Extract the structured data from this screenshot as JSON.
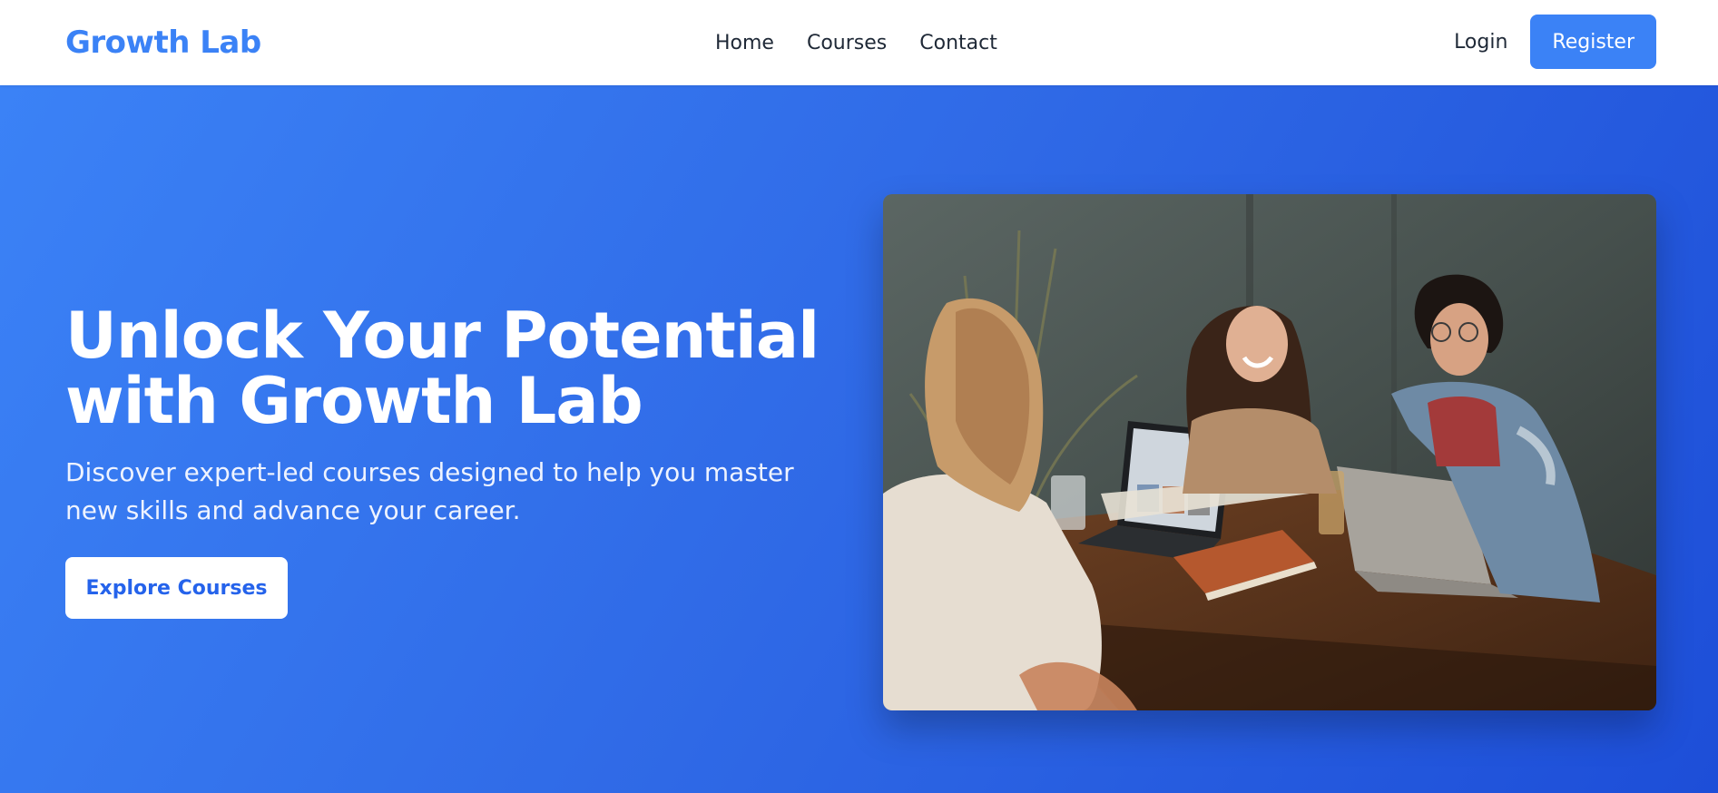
{
  "brand": {
    "name": "Growth Lab"
  },
  "nav": {
    "links": [
      "Home",
      "Courses",
      "Contact"
    ],
    "login": "Login",
    "register": "Register"
  },
  "hero": {
    "title_line1": "Unlock Your Potential",
    "title_line2": "with Growth Lab",
    "subtitle": "Discover expert-led courses designed to help you master new skills and advance your career.",
    "cta": "Explore Courses",
    "image_alt": "three-people-laughing-at-table-with-laptops-photo"
  },
  "colors": {
    "brand": "#3b82f6",
    "hero_gradient_start": "#3b82f6",
    "hero_gradient_end": "#1d4ed8",
    "cta_text": "#2563eb"
  }
}
